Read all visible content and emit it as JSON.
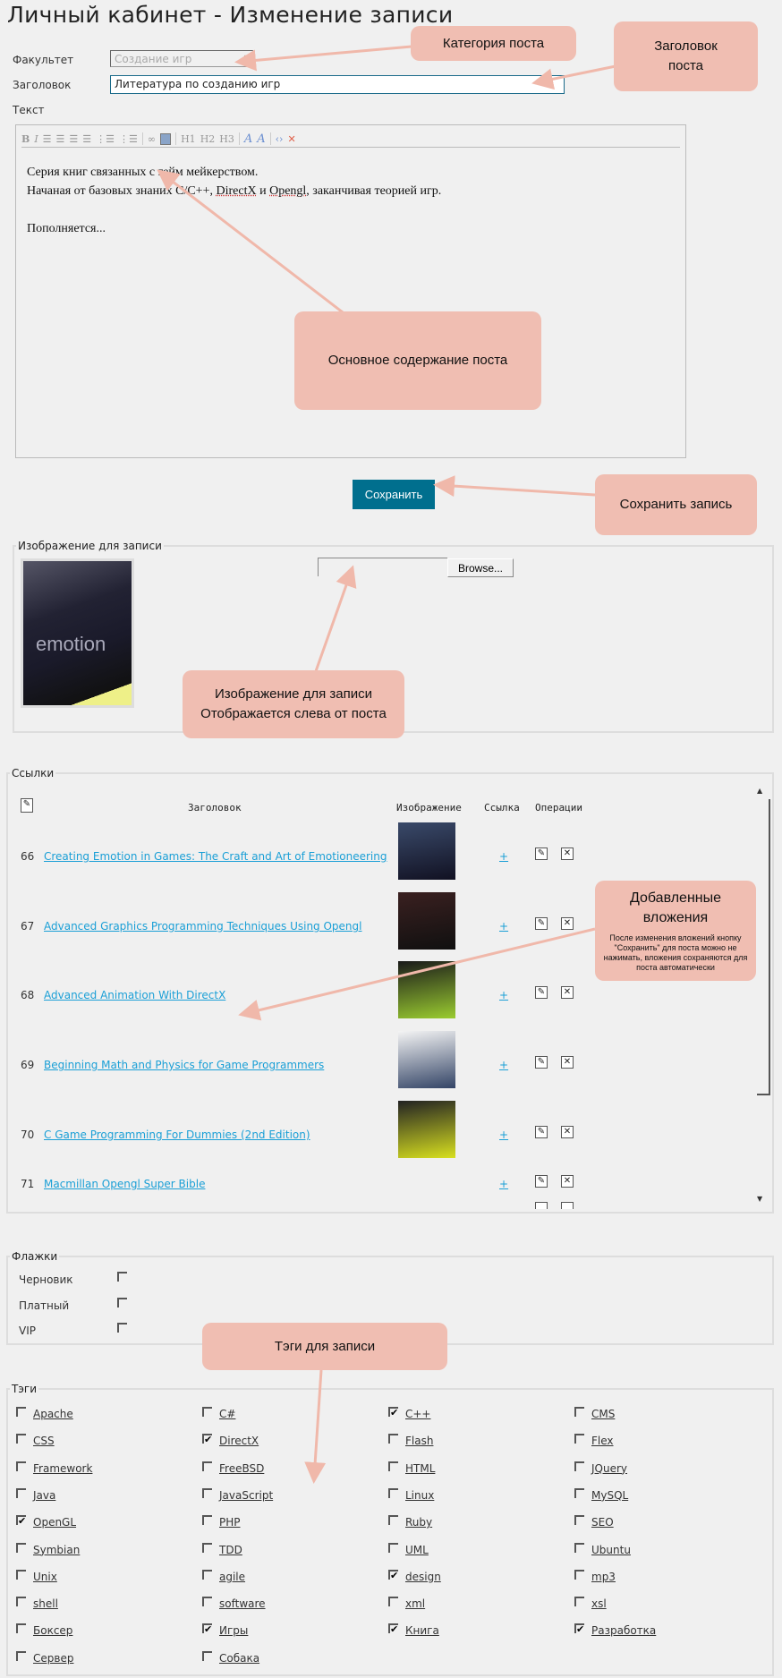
{
  "page_title": "Личный кабинет - Изменение записи",
  "form": {
    "faculty_label": "Факультет",
    "faculty_value": "Создание игр",
    "title_label": "Заголовок",
    "title_value": "Литература по созданию игр",
    "text_label": "Текст",
    "toolbar": [
      "bold",
      "italic",
      "align-left",
      "align-right",
      "indent",
      "outdent",
      "ordered-list",
      "unordered-list",
      "link",
      "image",
      "H1",
      "H2",
      "H3",
      "text-color",
      "bg-color",
      "source",
      "remove-format"
    ],
    "toolbar_labels": {
      "b": "B",
      "i": "I",
      "h1": "H1",
      "h2": "H2",
      "h3": "H3"
    },
    "text_lines": [
      "Серия книг связанных с гейм мейкерством.",
      "Начаная от базовых знаних C/C++, ",
      "DirectX",
      " и ",
      "Opengl",
      ", заканчивая теорией игр.",
      "Пополняется..."
    ],
    "save_label": "Сохранить"
  },
  "image_section": {
    "legend": "Изображение для записи",
    "browse_label": "Browse...",
    "cover_text": "emotion"
  },
  "links": {
    "legend": "Ссылки",
    "headers": [
      "Заголовок",
      "Изображение",
      "Ссылка",
      "Операции"
    ],
    "rows": [
      {
        "id": "66",
        "title": "Creating Emotion in Games: The Craft and Art of Emotioneering",
        "link": "+",
        "cover_colors": [
          "#3a4a6a",
          "#111122"
        ]
      },
      {
        "id": "67",
        "title": "Advanced Graphics Programming Techniques Using Opengl",
        "link": "+",
        "cover_colors": [
          "#3a2020",
          "#101010"
        ]
      },
      {
        "id": "68",
        "title": "Advanced Animation With DirectX",
        "link": "+",
        "cover_colors": [
          "#1a1a1a",
          "#9acc30"
        ]
      },
      {
        "id": "69",
        "title": "Beginning Math and Physics for Game Programmers",
        "link": "+",
        "cover_colors": [
          "#f4f4f4",
          "#334466"
        ]
      },
      {
        "id": "70",
        "title": "C Game Programming For Dummies (2nd Edition)",
        "link": "+",
        "cover_colors": [
          "#222222",
          "#d8e020"
        ]
      },
      {
        "id": "71",
        "title": "Macmillan Opengl Super Bible",
        "link": "+",
        "cover_colors": null
      }
    ]
  },
  "flags": {
    "legend": "Флажки",
    "items": [
      {
        "label": "Черновик",
        "checked": false
      },
      {
        "label": "Платный",
        "checked": false
      },
      {
        "label": "VIP",
        "checked": false
      }
    ]
  },
  "tags": {
    "legend": "Тэги",
    "items": [
      {
        "label": "Apache",
        "checked": false
      },
      {
        "label": "C#",
        "checked": false
      },
      {
        "label": "C++",
        "checked": true
      },
      {
        "label": "CMS",
        "checked": false
      },
      {
        "label": "CSS",
        "checked": false
      },
      {
        "label": "DirectX",
        "checked": true
      },
      {
        "label": "Flash",
        "checked": false
      },
      {
        "label": "Flex",
        "checked": false
      },
      {
        "label": "Framework",
        "checked": false
      },
      {
        "label": "FreeBSD",
        "checked": false
      },
      {
        "label": "HTML",
        "checked": false
      },
      {
        "label": "JQuery",
        "checked": false
      },
      {
        "label": "Java",
        "checked": false
      },
      {
        "label": "JavaScript",
        "checked": false
      },
      {
        "label": "Linux",
        "checked": false
      },
      {
        "label": "MySQL",
        "checked": false
      },
      {
        "label": "OpenGL",
        "checked": true
      },
      {
        "label": "PHP",
        "checked": false
      },
      {
        "label": "Ruby",
        "checked": false
      },
      {
        "label": "SEO",
        "checked": false
      },
      {
        "label": "Symbian",
        "checked": false
      },
      {
        "label": "TDD",
        "checked": false
      },
      {
        "label": "UML",
        "checked": false
      },
      {
        "label": "Ubuntu",
        "checked": false
      },
      {
        "label": "Unix",
        "checked": false
      },
      {
        "label": "agile",
        "checked": false
      },
      {
        "label": "design",
        "checked": true
      },
      {
        "label": "mp3",
        "checked": false
      },
      {
        "label": "shell",
        "checked": false
      },
      {
        "label": "software",
        "checked": false
      },
      {
        "label": "xml",
        "checked": false
      },
      {
        "label": "xsl",
        "checked": false
      },
      {
        "label": "Боксер",
        "checked": false
      },
      {
        "label": "Игры",
        "checked": true
      },
      {
        "label": "Книга",
        "checked": true
      },
      {
        "label": "Разработка",
        "checked": true
      },
      {
        "label": "Сервер",
        "checked": false
      },
      {
        "label": "Собака",
        "checked": false
      }
    ]
  },
  "annotations": {
    "category": "Категория поста",
    "title": "Заголовок поста",
    "content": "Основное содержание поста",
    "save": "Сохранить запись",
    "image_1": "Изображение для записи",
    "image_2": "Отображается слева от поста",
    "attachments_title": "Добавленные вложения",
    "attachments_note": "После изменения вложений кнопку \"Сохранить\" для поста можно не нажимать, вложения сохраняются для поста автоматически",
    "tags": "Тэги для записи"
  },
  "colors": {
    "accent": "#006f8e",
    "link": "#1a9fd6",
    "annotation": "#f0beb2",
    "arrow": "#f0b8aa"
  }
}
